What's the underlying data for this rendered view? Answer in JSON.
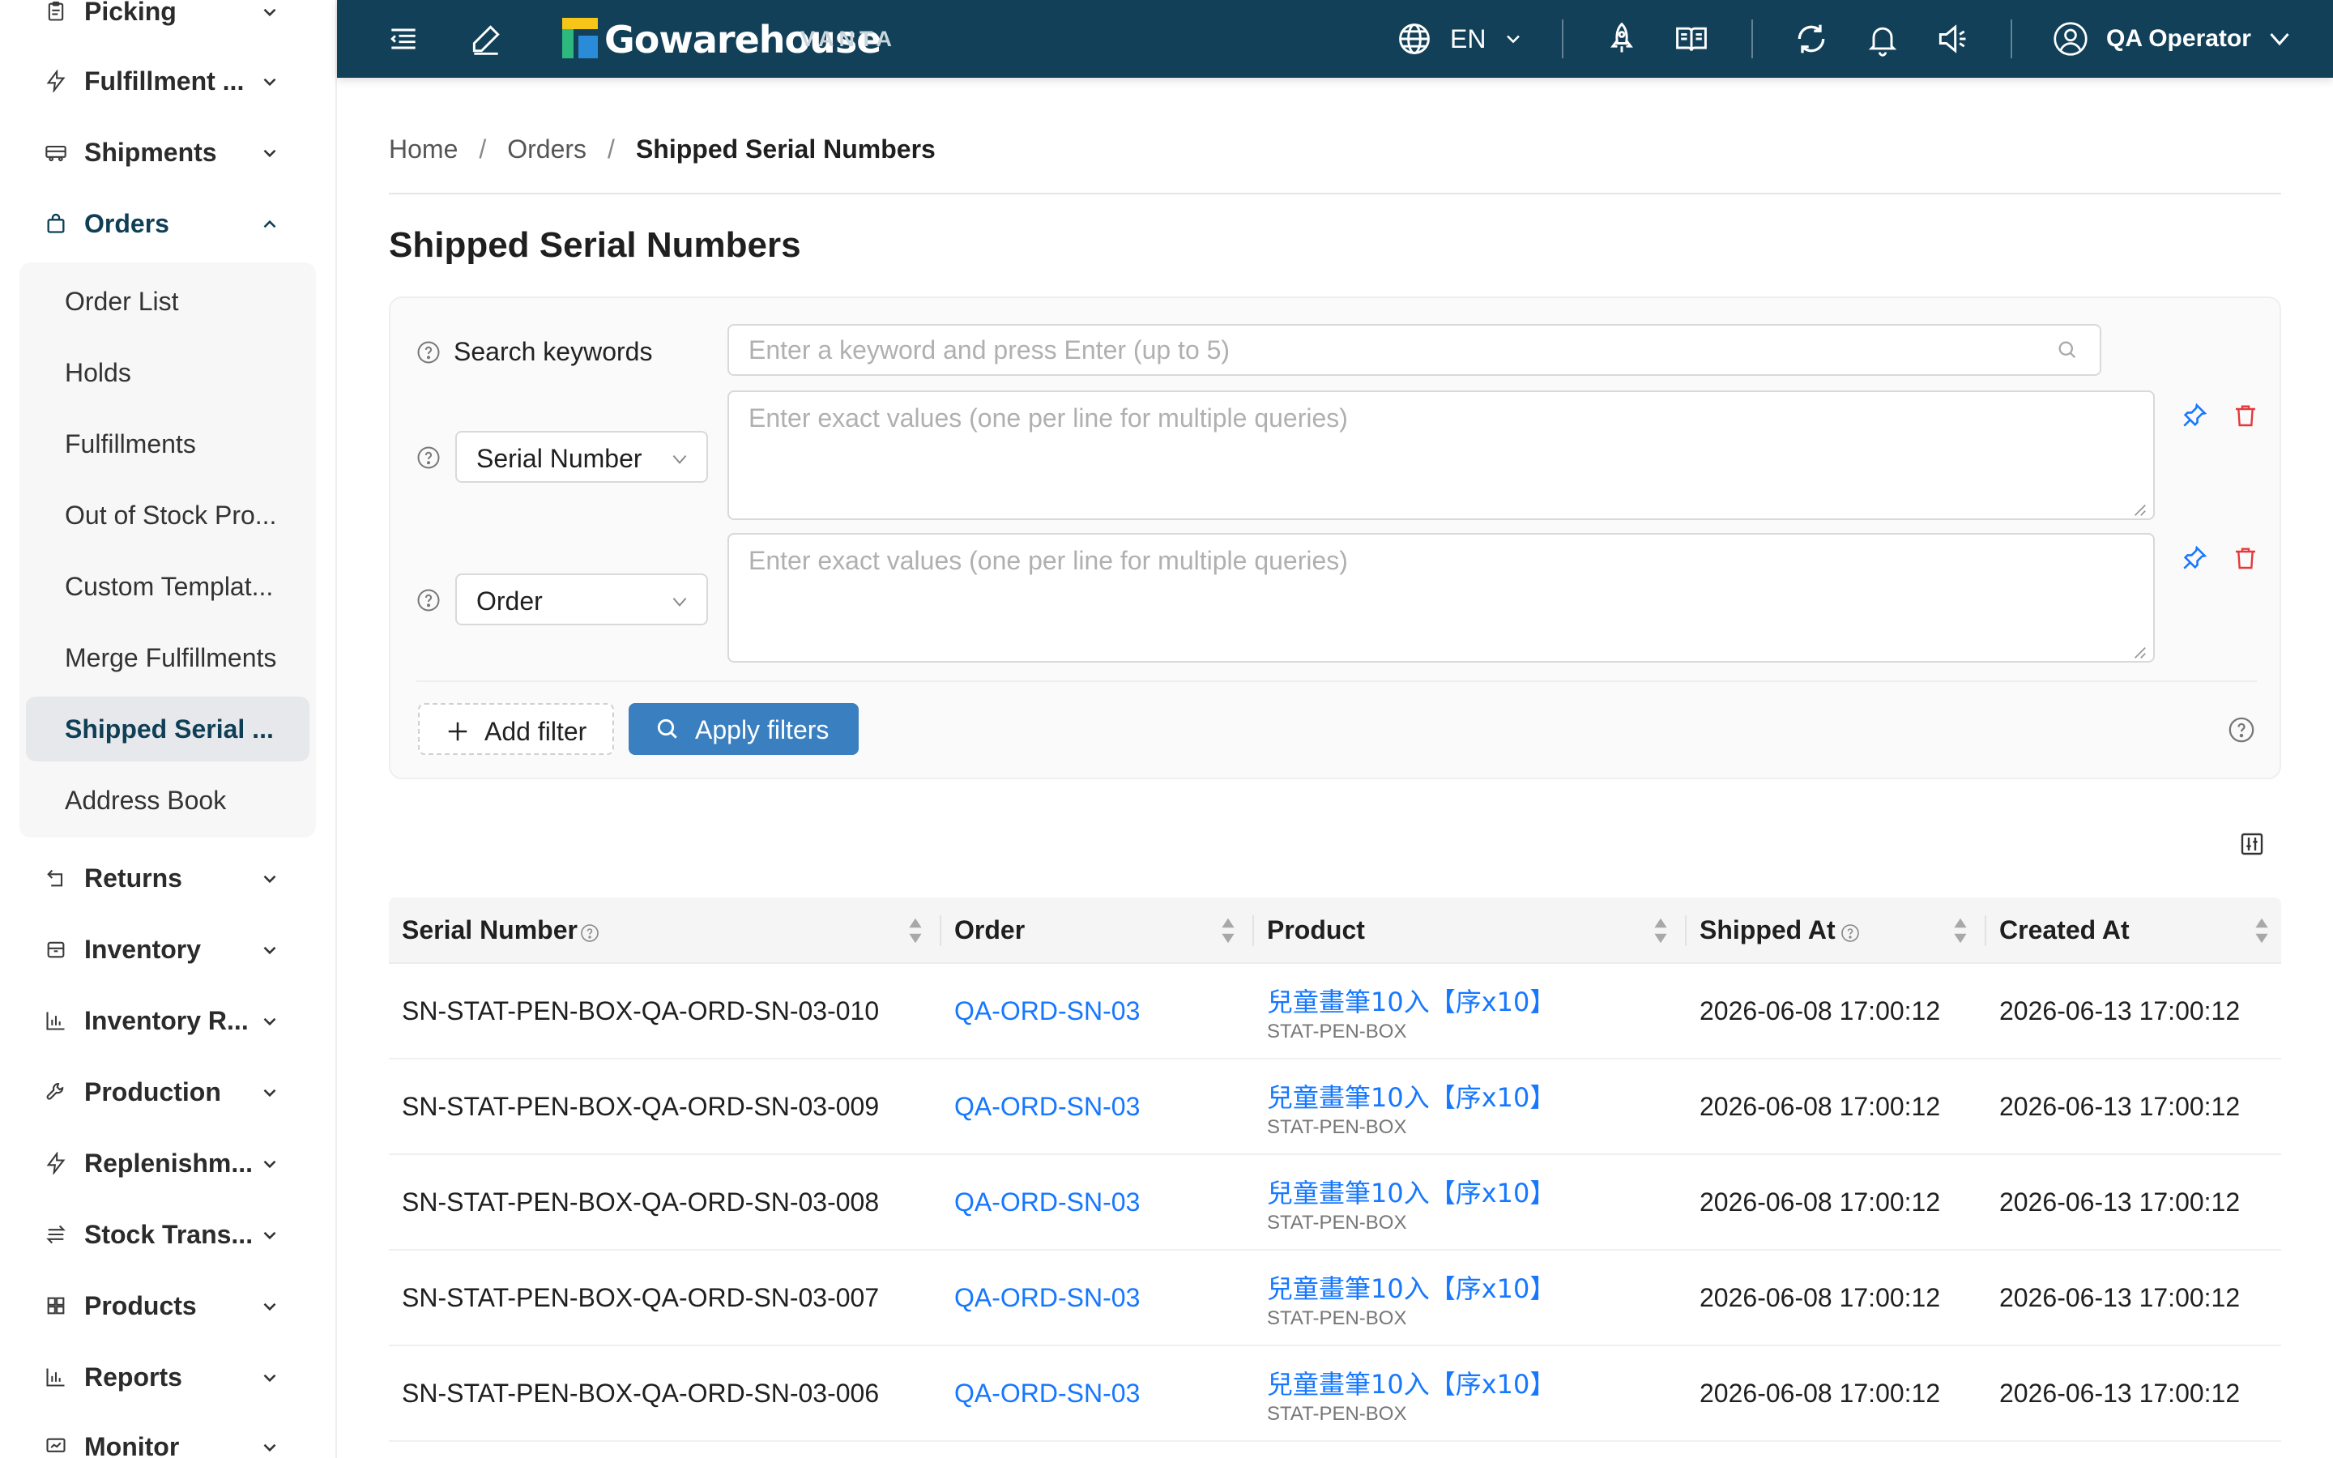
{
  "sidebar": {
    "items": [
      {
        "label": "Picking",
        "icon": "clipboard-icon"
      },
      {
        "label": "Fulfillment ...",
        "icon": "lightning-icon"
      },
      {
        "label": "Shipments",
        "icon": "truck-icon"
      },
      {
        "label": "Orders",
        "icon": "shopping-bag-icon"
      },
      {
        "label": "Returns",
        "icon": "return-icon"
      },
      {
        "label": "Inventory",
        "icon": "box-icon"
      },
      {
        "label": "Inventory R...",
        "icon": "bar-chart-icon"
      },
      {
        "label": "Production",
        "icon": "wrench-icon"
      },
      {
        "label": "Replenishm...",
        "icon": "lightning-icon"
      },
      {
        "label": "Stock Trans...",
        "icon": "transfer-icon"
      },
      {
        "label": "Products",
        "icon": "grid-icon"
      },
      {
        "label": "Reports",
        "icon": "bar-chart-icon"
      },
      {
        "label": "Monitor",
        "icon": "monitor-icon"
      }
    ],
    "orders_submenu": [
      {
        "label": "Order List"
      },
      {
        "label": "Holds"
      },
      {
        "label": "Fulfillments"
      },
      {
        "label": "Out of Stock Pro..."
      },
      {
        "label": "Custom Templat..."
      },
      {
        "label": "Merge Fulfillments"
      },
      {
        "label": "Shipped Serial ..."
      },
      {
        "label": "Address Book"
      }
    ],
    "selected_submenu": "Shipped Serial ..."
  },
  "topbar": {
    "brand_name": "Gowarehouse",
    "brand_sub": "VANTA",
    "language": "EN",
    "user_name": "QA Operator",
    "colors": {
      "bar": "#114058",
      "logo_yellow": "#f5c518",
      "logo_green": "#2db87d",
      "logo_blue": "#2a8bd8"
    }
  },
  "breadcrumb": {
    "home": "Home",
    "orders": "Orders",
    "current": "Shipped Serial Numbers",
    "separator": "/"
  },
  "page": {
    "title": "Shipped Serial Numbers"
  },
  "filters": {
    "keywords_label": "Search keywords",
    "keywords_placeholder": "Enter a keyword and press Enter (up to 5)",
    "rows": [
      {
        "field": "Serial Number",
        "placeholder": "Enter exact values (one per line for multiple queries)"
      },
      {
        "field": "Order",
        "placeholder": "Enter exact values (one per line for multiple queries)"
      }
    ],
    "add_filter_label": "Add filter",
    "apply_filters_label": "Apply filters"
  },
  "table": {
    "columns": [
      "Serial Number",
      "Order",
      "Product",
      "Shipped At",
      "Created At"
    ],
    "rows": [
      {
        "serial": "SN-STAT-PEN-BOX-QA-ORD-SN-03-010",
        "order": "QA-ORD-SN-03",
        "product": "兒童畫筆10入【序x10】",
        "sku": "STAT-PEN-BOX",
        "shipped_at": "2026-06-08 17:00:12",
        "created_at": "2026-06-13 17:00:12"
      },
      {
        "serial": "SN-STAT-PEN-BOX-QA-ORD-SN-03-009",
        "order": "QA-ORD-SN-03",
        "product": "兒童畫筆10入【序x10】",
        "sku": "STAT-PEN-BOX",
        "shipped_at": "2026-06-08 17:00:12",
        "created_at": "2026-06-13 17:00:12"
      },
      {
        "serial": "SN-STAT-PEN-BOX-QA-ORD-SN-03-008",
        "order": "QA-ORD-SN-03",
        "product": "兒童畫筆10入【序x10】",
        "sku": "STAT-PEN-BOX",
        "shipped_at": "2026-06-08 17:00:12",
        "created_at": "2026-06-13 17:00:12"
      },
      {
        "serial": "SN-STAT-PEN-BOX-QA-ORD-SN-03-007",
        "order": "QA-ORD-SN-03",
        "product": "兒童畫筆10入【序x10】",
        "sku": "STAT-PEN-BOX",
        "shipped_at": "2026-06-08 17:00:12",
        "created_at": "2026-06-13 17:00:12"
      },
      {
        "serial": "SN-STAT-PEN-BOX-QA-ORD-SN-03-006",
        "order": "QA-ORD-SN-03",
        "product": "兒童畫筆10入【序x10】",
        "sku": "STAT-PEN-BOX",
        "shipped_at": "2026-06-08 17:00:12",
        "created_at": "2026-06-13 17:00:12"
      }
    ]
  },
  "colors": {
    "link": "#1677ff",
    "primary_button": "#3a7fbf",
    "danger": "#e5383b",
    "active_nav": "#0f3f56"
  }
}
